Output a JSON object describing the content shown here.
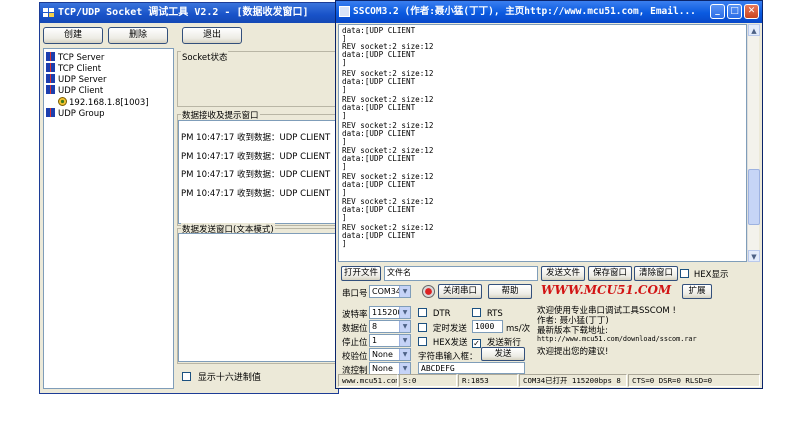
{
  "tcp_window": {
    "title": "TCP/UDP Socket 调试工具 V2.2 - [数据收发窗口]",
    "buttons": {
      "create": "创建",
      "delete": "删除",
      "exit": "退出"
    },
    "tree": [
      {
        "label": "TCP Server"
      },
      {
        "label": "TCP Client"
      },
      {
        "label": "UDP Server"
      },
      {
        "label": "UDP Client"
      },
      {
        "label": "192.168.1.8[1003]"
      },
      {
        "label": "UDP Group"
      }
    ],
    "socket_status_label": "Socket状态",
    "recv_group_label": "数据接收及提示窗口",
    "recv_lines": [
      "PM 10:47:17 收到数据：UDP CLIENT",
      "PM 10:47:17 收到数据：UDP CLIENT",
      "PM 10:47:17 收到数据：UDP CLIENT",
      "PM 10:47:17 收到数据：UDP CLIENT"
    ],
    "send_group_label": "数据发送窗口(文本模式)",
    "hex_checkbox_label": "显示十六进制值"
  },
  "sscom_window": {
    "title": "SSCOM3.2 (作者:聂小猛(丁丁), 主页http://www.mcu51.com,  Email...",
    "terminal_lines": [
      "data:[UDP CLIENT",
      "]",
      "REV socket:2 size:12",
      "data:[UDP CLIENT",
      "]",
      "REV socket:2 size:12",
      "data:[UDP CLIENT",
      "]",
      "REV socket:2 size:12",
      "data:[UDP CLIENT",
      "]",
      "REV socket:2 size:12",
      "data:[UDP CLIENT",
      "]",
      "REV socket:2 size:12",
      "data:[UDP CLIENT",
      "]",
      "REV socket:2 size:12",
      "data:[UDP CLIENT",
      "]",
      "REV socket:2 size:12",
      "data:[UDP CLIENT",
      "]",
      "REV socket:2 size:12",
      "data:[UDP CLIENT",
      "]"
    ],
    "open_file_button": "打开文件",
    "file_name_value": "文件名",
    "send_file_button": "发送文件",
    "save_window_button": "保存窗口",
    "clear_window_button": "清除窗口",
    "hex_display_label": "HEX显示",
    "port_label": "串口号",
    "port_value": "COM34",
    "close_port_button": "关闭串口",
    "help_button": "帮助",
    "logo_text": "WWW.MCU51.COM",
    "expand_button": "扩展",
    "baud_label": "波特率",
    "baud_value": "115200",
    "databits_label": "数据位",
    "databits_value": "8",
    "stopbits_label": "停止位",
    "stopbits_value": "1",
    "parity_label": "校验位",
    "parity_value": "None",
    "flow_label": "流控制",
    "flow_value": "None",
    "dtr_label": "DTR",
    "rts_label": "RTS",
    "timed_send_label": "定时发送",
    "interval_value": "1000",
    "interval_unit": "ms/次",
    "hex_send_label": "HEX发送",
    "send_newline_label": "发送新行",
    "input_string_label": "字符串输入框：",
    "send_button": "发送",
    "send_input_value": "ABCDEFG",
    "info_lines": [
      "欢迎使用专业串口调试工具SSCOM !",
      "作者: 聂小猛(丁丁)",
      "最新版本下载地址:",
      "http://www.mcu51.com/download/sscom.rar",
      "欢迎提出您的建议!"
    ],
    "status": {
      "site": "www.mcu51.com",
      "s": "S:0",
      "r": "R:1853",
      "port_state": "COM34已打开  115200bps  8",
      "lines": "CTS=0 DSR=0 RLSD=0"
    }
  }
}
